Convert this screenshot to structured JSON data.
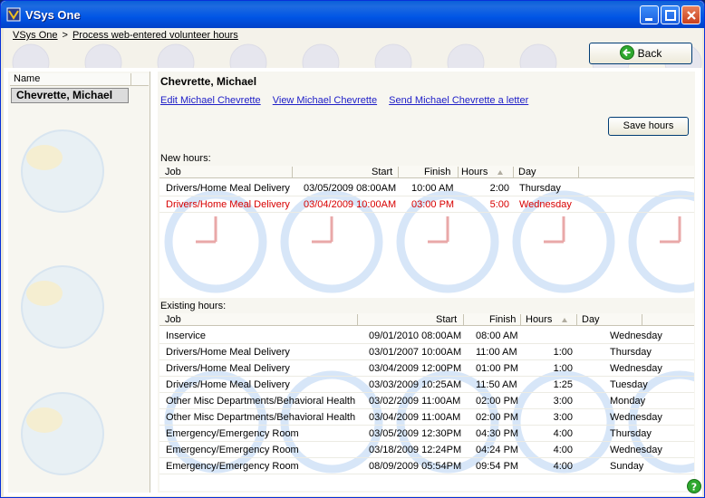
{
  "window": {
    "title": "VSys One"
  },
  "breadcrumb": {
    "home": "VSys One",
    "separator": ">",
    "current": "Process web-entered volunteer hours"
  },
  "toolbar": {
    "back_label": "Back"
  },
  "left_panel": {
    "column_header": "Name",
    "selected_name": "Chevrette, Michael"
  },
  "right_panel": {
    "person_title": "Chevrette, Michael",
    "links": [
      "Edit Michael Chevrette",
      "View Michael Chevrette",
      "Send Michael Chevrette a letter"
    ],
    "save_label": "Save hours"
  },
  "new_hours": {
    "label": "New hours:",
    "columns": [
      "Job",
      "Start",
      "Finish",
      "Hours",
      "Day"
    ],
    "rows": [
      {
        "job": "Drivers/Home Meal Delivery",
        "start": "03/05/2009 08:00AM",
        "finish": "10:00 AM",
        "hours": "2:00",
        "day": "Thursday"
      },
      {
        "job": "Drivers/Home Meal Delivery",
        "start": "03/04/2009 10:00AM",
        "finish": "03:00 PM",
        "hours": "5:00",
        "day": "Wednesday"
      }
    ]
  },
  "existing_hours": {
    "label": "Existing hours:",
    "columns": [
      "Job",
      "Start",
      "Finish",
      "Hours",
      "Day"
    ],
    "rows": [
      {
        "job": "Inservice",
        "start": "09/01/2010 08:00AM",
        "finish": "08:00 AM",
        "hours": "",
        "day": "Wednesday"
      },
      {
        "job": "Drivers/Home Meal Delivery",
        "start": "03/01/2007 10:00AM",
        "finish": "11:00 AM",
        "hours": "1:00",
        "day": "Thursday"
      },
      {
        "job": "Drivers/Home Meal Delivery",
        "start": "03/04/2009 12:00PM",
        "finish": "01:00 PM",
        "hours": "1:00",
        "day": "Wednesday"
      },
      {
        "job": "Drivers/Home Meal Delivery",
        "start": "03/03/2009 10:25AM",
        "finish": "11:50 AM",
        "hours": "1:25",
        "day": "Tuesday"
      },
      {
        "job": "Other Misc Departments/Behavioral Health",
        "start": "03/02/2009 11:00AM",
        "finish": "02:00 PM",
        "hours": "3:00",
        "day": "Monday"
      },
      {
        "job": "Other Misc Departments/Behavioral Health",
        "start": "03/04/2009 11:00AM",
        "finish": "02:00 PM",
        "hours": "3:00",
        "day": "Wednesday"
      },
      {
        "job": "Emergency/Emergency Room",
        "start": "03/05/2009 12:30PM",
        "finish": "04:30 PM",
        "hours": "4:00",
        "day": "Thursday"
      },
      {
        "job": "Emergency/Emergency Room",
        "start": "03/18/2009 12:24PM",
        "finish": "04:24 PM",
        "hours": "4:00",
        "day": "Wednesday"
      },
      {
        "job": "Emergency/Emergency Room",
        "start": "08/09/2009 05:54PM",
        "finish": "09:54 PM",
        "hours": "4:00",
        "day": "Sunday"
      }
    ]
  },
  "icons": {
    "app": "vsys-logo-icon",
    "back": "green-arrow-left-icon",
    "help": "help-icon",
    "sort": "sort-ascending-icon"
  },
  "colors": {
    "title_bar": "#0055e5",
    "link": "#2020c8",
    "highlight_row": "#d80000",
    "clock_ring": "#a8c8f0"
  }
}
